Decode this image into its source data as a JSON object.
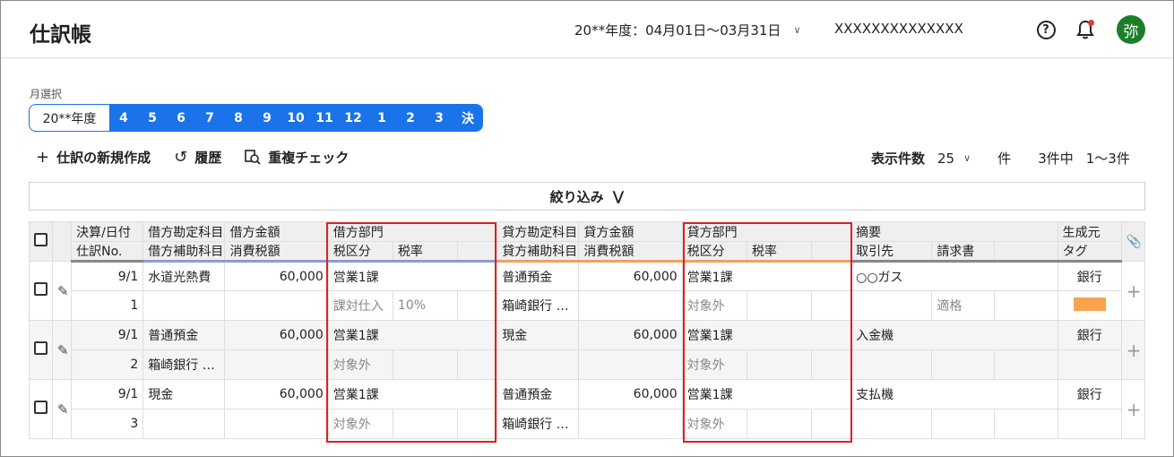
{
  "header": {
    "title": "仕訳帳",
    "fiscal_period": "20**年度：04月01日〜03月31日",
    "company": "XXXXXXXXXXXXXX",
    "avatar_char": "弥"
  },
  "months": {
    "label": "月選択",
    "year": "20**年度",
    "items": [
      "4",
      "5",
      "6",
      "7",
      "8",
      "9",
      "10",
      "11",
      "12",
      "1",
      "2",
      "3",
      "決"
    ]
  },
  "toolbar": {
    "new_label": "仕訳の新規作成",
    "history_label": "履歴",
    "duplicate_label": "重複チェック"
  },
  "paging": {
    "display_count_label": "表示件数",
    "page_size": "25",
    "unit": "件",
    "total": "3件中",
    "range": "1〜3件"
  },
  "filter": {
    "label": "絞り込み"
  },
  "table": {
    "headers_row1": [
      "決算/日付",
      "借方勘定科目",
      "借方金額",
      "借方部門",
      "",
      "",
      "貸方勘定科目",
      "貸方金額",
      "貸方部門",
      "",
      "",
      "摘要",
      "",
      "",
      "生成元"
    ],
    "headers_row2": [
      "仕訳No.",
      "借方補助科目",
      "消費税額",
      "税区分",
      "税率",
      "",
      "貸方補助科目",
      "消費税額",
      "税区分",
      "税率",
      "",
      "取引先",
      "請求書",
      "",
      "タグ"
    ],
    "rows": [
      {
        "date": "9/1",
        "no": "1",
        "debit_account": "水道光熱費",
        "debit_sub": "",
        "debit_amount": "60,000",
        "debit_tax_amount": "",
        "debit_dept": "営業1課",
        "debit_tax_class": "課対仕入",
        "debit_tax_rate": "10%",
        "credit_account": "普通預金",
        "credit_sub": "箱崎銀行 …",
        "credit_amount": "60,000",
        "credit_tax_amount": "",
        "credit_dept": "営業1課",
        "credit_tax_class": "対象外",
        "credit_tax_rate": "",
        "summary": "○○ガス",
        "partner": "",
        "invoice": "適格",
        "source": "銀行",
        "tag_color": "#f8a44e"
      },
      {
        "date": "9/1",
        "no": "2",
        "debit_account": "普通預金",
        "debit_sub": "箱崎銀行 …",
        "debit_amount": "60,000",
        "debit_tax_amount": "",
        "debit_dept": "営業1課",
        "debit_tax_class": "対象外",
        "debit_tax_rate": "",
        "credit_account": "現金",
        "credit_sub": "",
        "credit_amount": "60,000",
        "credit_tax_amount": "",
        "credit_dept": "営業1課",
        "credit_tax_class": "対象外",
        "credit_tax_rate": "",
        "summary": "入金機",
        "partner": "",
        "invoice": "",
        "source": "銀行"
      },
      {
        "date": "9/1",
        "no": "3",
        "debit_account": "現金",
        "debit_sub": "",
        "debit_amount": "60,000",
        "debit_tax_amount": "",
        "debit_dept": "営業1課",
        "debit_tax_class": "対象外",
        "debit_tax_rate": "",
        "credit_account": "普通預金",
        "credit_sub": "箱崎銀行 …",
        "credit_amount": "60,000",
        "credit_tax_amount": "",
        "credit_dept": "営業1課",
        "credit_tax_class": "対象外",
        "credit_tax_rate": "",
        "summary": "支払機",
        "partner": "",
        "invoice": "",
        "source": "銀行"
      }
    ]
  }
}
